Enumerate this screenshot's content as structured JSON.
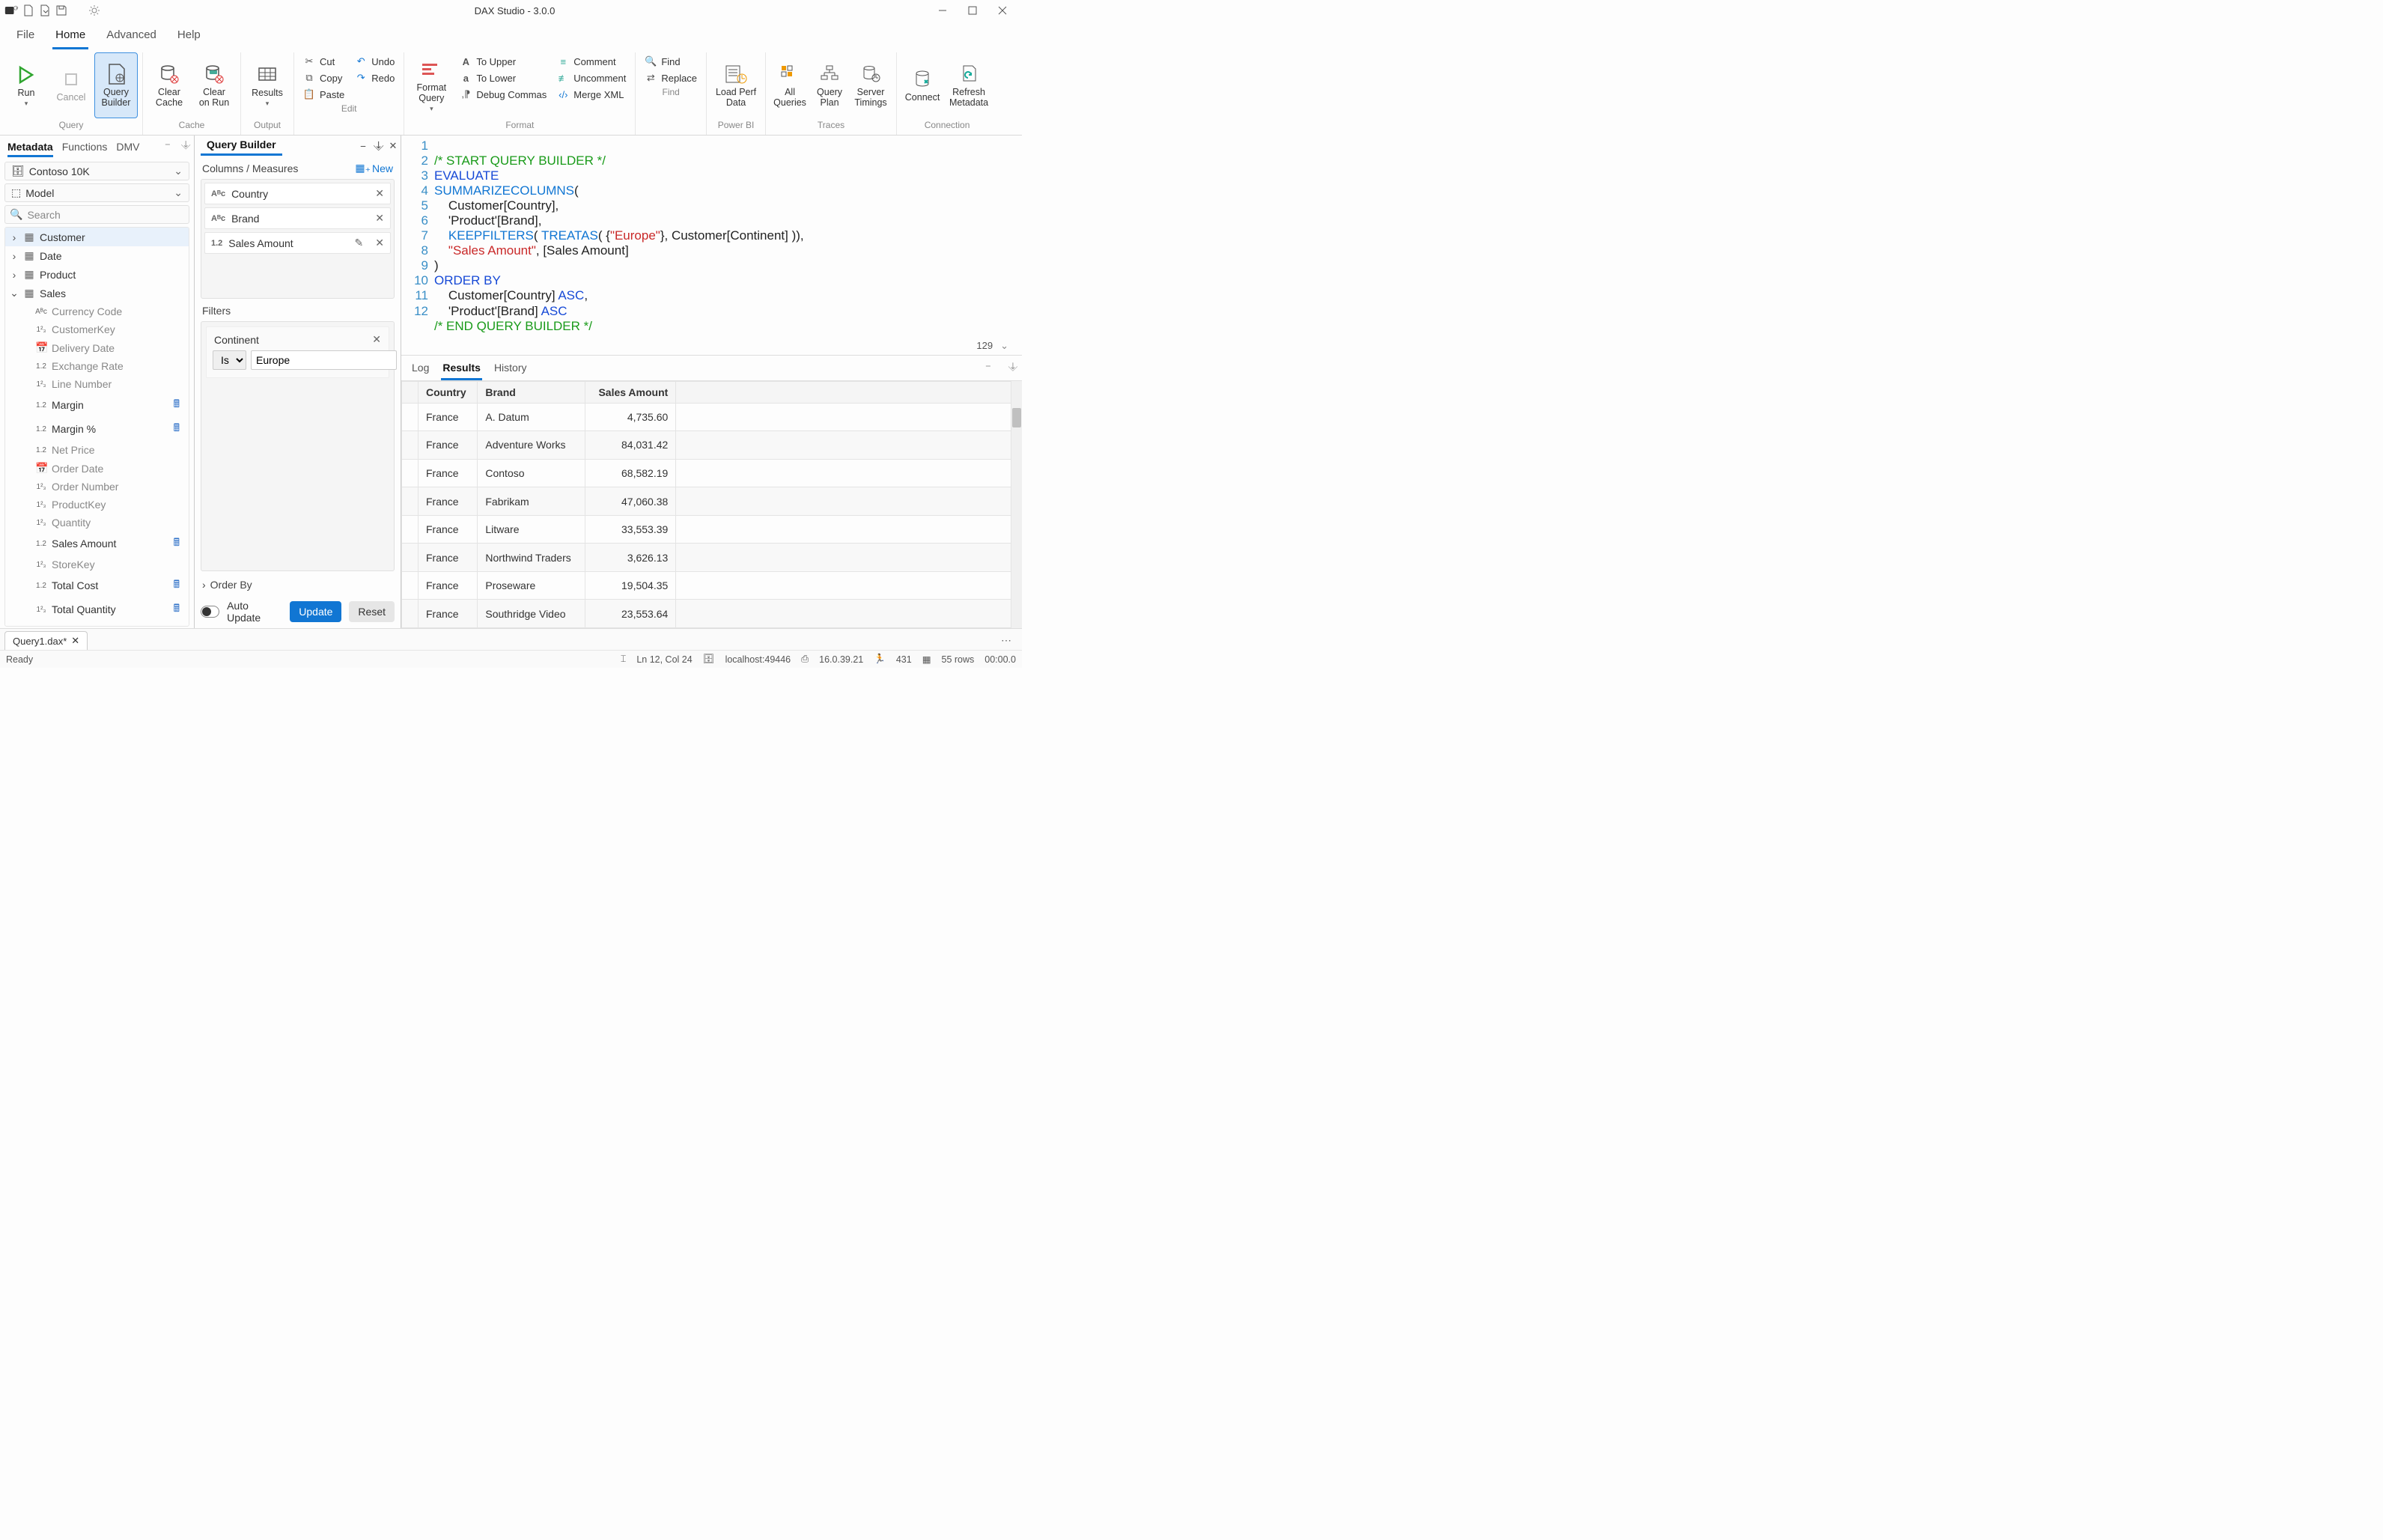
{
  "window": {
    "title": "DAX Studio - 3.0.0"
  },
  "ribbon_tabs": {
    "file": "File",
    "home": "Home",
    "advanced": "Advanced",
    "help": "Help"
  },
  "ribbon": {
    "run": "Run",
    "cancel": "Cancel",
    "query_builder": "Query\nBuilder",
    "clear_cache": "Clear\nCache",
    "clear_on_run": "Clear\non Run",
    "results": "Results",
    "cut": "Cut",
    "copy": "Copy",
    "paste": "Paste",
    "undo": "Undo",
    "redo": "Redo",
    "format_query": "Format\nQuery",
    "to_upper": "To Upper",
    "to_lower": "To Lower",
    "debug_commas": "Debug Commas",
    "comment": "Comment",
    "uncomment": "Uncomment",
    "merge_xml": "Merge XML",
    "find": "Find",
    "replace": "Replace",
    "load_perf": "Load Perf\nData",
    "all_queries": "All\nQueries",
    "query_plan": "Query\nPlan",
    "server_timings": "Server\nTimings",
    "connect": "Connect",
    "refresh_metadata": "Refresh\nMetadata",
    "groups": {
      "query": "Query",
      "cache": "Cache",
      "output": "Output",
      "edit": "Edit",
      "format": "Format",
      "find": "Find",
      "powerbi": "Power BI",
      "traces": "Traces",
      "connection": "Connection"
    }
  },
  "metadata_tabs": {
    "metadata": "Metadata",
    "functions": "Functions",
    "dmv": "DMV"
  },
  "connection": {
    "db": "Contoso 10K",
    "model": "Model"
  },
  "search_placeholder": "Search",
  "tree": {
    "customer": "Customer",
    "date": "Date",
    "product": "Product",
    "sales": "Sales",
    "children": {
      "currency_code": "Currency Code",
      "customer_key": "CustomerKey",
      "delivery_date": "Delivery Date",
      "exchange_rate": "Exchange Rate",
      "line_number": "Line Number",
      "margin": "Margin",
      "margin_pct": "Margin %",
      "net_price": "Net Price",
      "order_date": "Order Date",
      "order_number": "Order Number",
      "product_key": "ProductKey",
      "quantity": "Quantity",
      "sales_amount": "Sales Amount",
      "store_key": "StoreKey",
      "total_cost": "Total Cost",
      "total_quantity": "Total Quantity"
    }
  },
  "qb": {
    "title": "Query Builder",
    "columns_label": "Columns / Measures",
    "new": "New",
    "items": {
      "country": "Country",
      "brand": "Brand",
      "sales_amount": "Sales Amount"
    },
    "types": {
      "abc": "Aᴮc",
      "num": "1.2"
    },
    "filters_label": "Filters",
    "filter": {
      "field": "Continent",
      "op": "Is",
      "value": "Europe"
    },
    "order_by": "Order By",
    "auto_update": "Auto Update",
    "update": "Update",
    "reset": "Reset"
  },
  "code": {
    "l1": "/* START QUERY BUILDER */",
    "l2": "EVALUATE",
    "l3": "SUMMARIZECOLUMNS",
    "l3b": "(",
    "l4": "    Customer[Country],",
    "l5a": "    'Product'[Brand]",
    "l5b": ",",
    "l6a": "    ",
    "l6b": "KEEPFILTERS",
    "l6c": "( ",
    "l6d": "TREATAS",
    "l6e": "( {",
    "l6f": "\"Europe\"",
    "l6g": "}, Customer[Continent] )),",
    "l7a": "    ",
    "l7b": "\"Sales Amount\"",
    "l7c": ", [Sales Amount]",
    "l8": ")",
    "l9": "ORDER BY",
    "l10a": "    Customer[Country] ",
    "l10b": "ASC",
    "l10c": ",",
    "l11a": "    'Product'[Brand] ",
    "l11b": "ASC",
    "l12": "/* END QUERY BUILDER */"
  },
  "editor_status": {
    "chars": "129"
  },
  "result_tabs": {
    "log": "Log",
    "results": "Results",
    "history": "History"
  },
  "grid": {
    "headers": {
      "country": "Country",
      "brand": "Brand",
      "sales_amount": "Sales Amount"
    },
    "rows": [
      {
        "country": "France",
        "brand": "A. Datum",
        "sales": "4,735.60"
      },
      {
        "country": "France",
        "brand": "Adventure Works",
        "sales": "84,031.42"
      },
      {
        "country": "France",
        "brand": "Contoso",
        "sales": "68,582.19"
      },
      {
        "country": "France",
        "brand": "Fabrikam",
        "sales": "47,060.38"
      },
      {
        "country": "France",
        "brand": "Litware",
        "sales": "33,553.39"
      },
      {
        "country": "France",
        "brand": "Northwind Traders",
        "sales": "3,626.13"
      },
      {
        "country": "France",
        "brand": "Proseware",
        "sales": "19,504.35"
      },
      {
        "country": "France",
        "brand": "Southridge Video",
        "sales": "23,553.64"
      }
    ]
  },
  "doctab": {
    "name": "Query1.dax*"
  },
  "status": {
    "ready": "Ready",
    "pos": "Ln 12, Col 24",
    "server": "localhost:49446",
    "version": "16.0.39.21",
    "spid": "431",
    "rows": "55 rows",
    "time": "00:00.0"
  }
}
